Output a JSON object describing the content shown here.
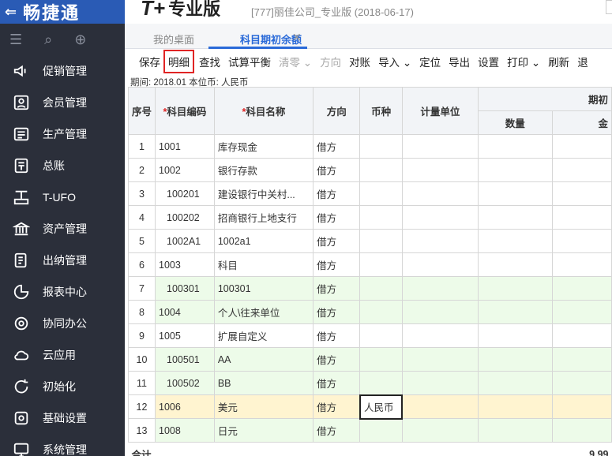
{
  "app": {
    "logo_text": "畅捷通",
    "product_name": "专业版",
    "product_prefix": "T+",
    "company_info": "[777]丽佳公司_专业版   (2018-06-17)"
  },
  "sidebar": {
    "items": [
      {
        "label": "促销管理",
        "icon": "megaphone-icon"
      },
      {
        "label": "会员管理",
        "icon": "member-icon"
      },
      {
        "label": "生产管理",
        "icon": "production-icon"
      },
      {
        "label": "总账",
        "icon": "ledger-icon"
      },
      {
        "label": "T-UFO",
        "icon": "ufo-icon"
      },
      {
        "label": "资产管理",
        "icon": "bank-icon"
      },
      {
        "label": "出纳管理",
        "icon": "cashier-icon"
      },
      {
        "label": "报表中心",
        "icon": "pie-chart-icon"
      },
      {
        "label": "协同办公",
        "icon": "collaboration-icon"
      },
      {
        "label": "云应用",
        "icon": "cloud-icon"
      },
      {
        "label": "初始化",
        "icon": "refresh-icon"
      },
      {
        "label": "基础设置",
        "icon": "settings-icon"
      },
      {
        "label": "系统管理",
        "icon": "system-icon"
      }
    ]
  },
  "tabs": {
    "desktop": "我的桌面",
    "current": "科目期初余额"
  },
  "toolbar": {
    "save": "保存",
    "detail": "明细",
    "find": "查找",
    "trial_balance": "试算平衡",
    "clear_zero": "清零",
    "direction": "方向",
    "reconcile": "对账",
    "import": "导入",
    "locate": "定位",
    "export": "导出",
    "settings": "设置",
    "print": "打印",
    "refresh": "刷新",
    "exit": "退"
  },
  "period": {
    "text": "期间: 2018.01    本位币: 人民币"
  },
  "table": {
    "headers": {
      "seq": "序号",
      "code": "科目编码",
      "name": "科目名称",
      "direction": "方向",
      "currency": "币种",
      "unit": "计量单位",
      "opening": "期初",
      "quantity": "数量",
      "amount": "金"
    },
    "rows": [
      {
        "seq": "1",
        "code": "1001",
        "name": "库存现金",
        "dir": "借方",
        "currency": ""
      },
      {
        "seq": "2",
        "code": "1002",
        "name": "银行存款",
        "dir": "借方",
        "currency": ""
      },
      {
        "seq": "3",
        "code": "100201",
        "name": "建设银行中关村...",
        "dir": "借方",
        "currency": ""
      },
      {
        "seq": "4",
        "code": "100202",
        "name": "招商银行上地支行",
        "dir": "借方",
        "currency": ""
      },
      {
        "seq": "5",
        "code": "1002A1",
        "name": "1002a1",
        "dir": "借方",
        "currency": ""
      },
      {
        "seq": "6",
        "code": "1003",
        "name": "科目",
        "dir": "借方",
        "currency": ""
      },
      {
        "seq": "7",
        "code": "100301",
        "name": "100301",
        "dir": "借方",
        "currency": ""
      },
      {
        "seq": "8",
        "code": "1004",
        "name": "个人\\往来单位",
        "dir": "借方",
        "currency": ""
      },
      {
        "seq": "9",
        "code": "1005",
        "name": "扩展自定义",
        "dir": "借方",
        "currency": ""
      },
      {
        "seq": "10",
        "code": "100501",
        "name": "AA",
        "dir": "借方",
        "currency": ""
      },
      {
        "seq": "11",
        "code": "100502",
        "name": "BB",
        "dir": "借方",
        "currency": ""
      },
      {
        "seq": "12",
        "code": "1006",
        "name": "美元",
        "dir": "借方",
        "currency": "人民币"
      },
      {
        "seq": "13",
        "code": "1008",
        "name": "日元",
        "dir": "借方",
        "currency": ""
      }
    ],
    "total_label": "合计",
    "total_value": "9,99"
  }
}
